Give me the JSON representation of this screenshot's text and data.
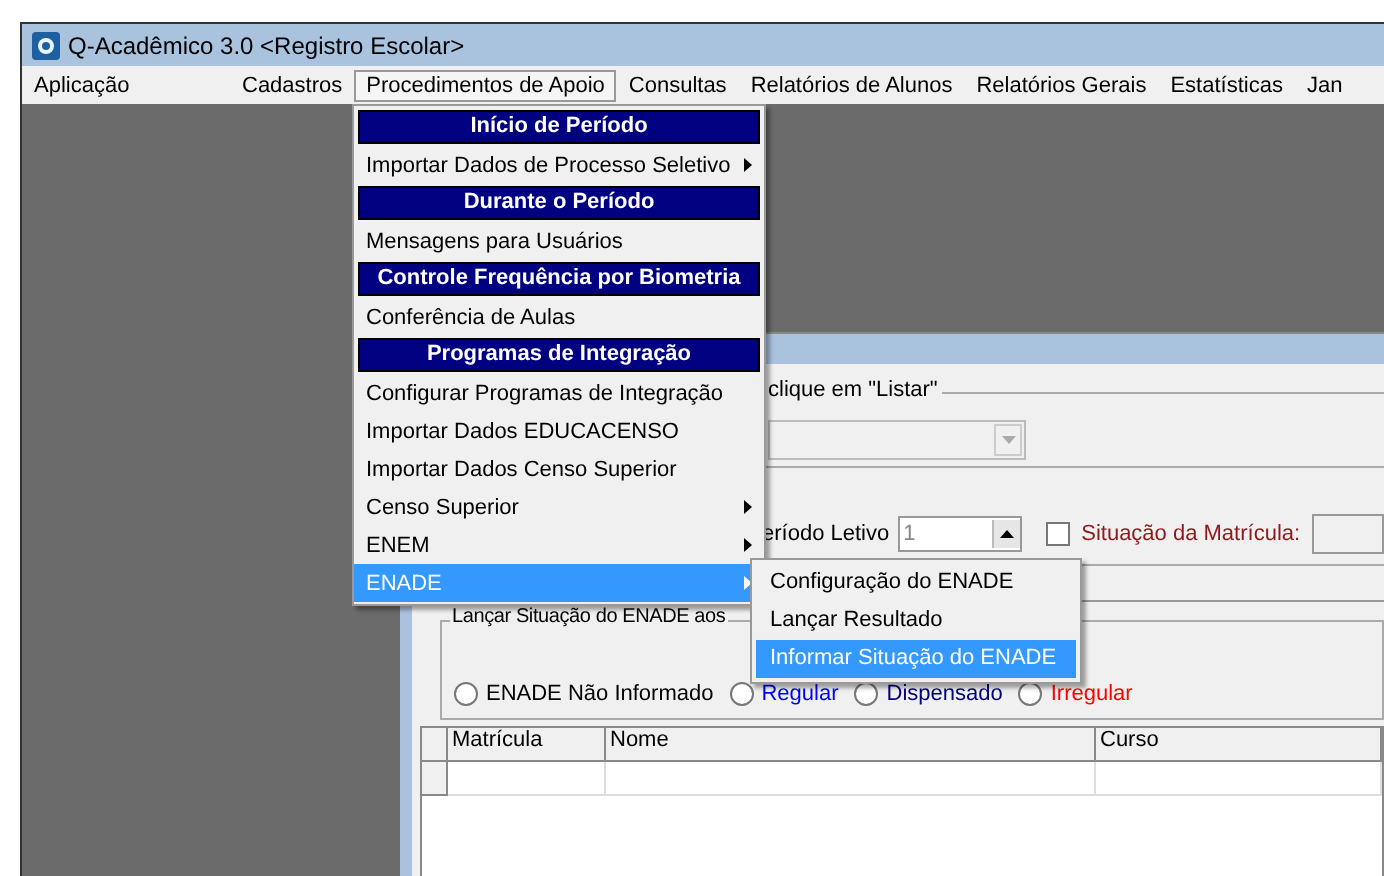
{
  "window": {
    "title": "Q-Acadêmico 3.0 <Registro Escolar>"
  },
  "menubar": [
    {
      "label": "Aplicação",
      "selected": false
    },
    {
      "label": "Cadastros",
      "selected": false
    },
    {
      "label": "Procedimentos de Apoio",
      "selected": true
    },
    {
      "label": "Consultas",
      "selected": false
    },
    {
      "label": "Relatórios de Alunos",
      "selected": false
    },
    {
      "label": "Relatórios Gerais",
      "selected": false
    },
    {
      "label": "Estatísticas",
      "selected": false
    },
    {
      "label": "Jan",
      "selected": false
    }
  ],
  "dropdown": {
    "items": [
      {
        "kind": "header",
        "label": "Início de Período"
      },
      {
        "kind": "item",
        "label": "Importar Dados de Processo Seletivo",
        "submenu": true,
        "selected": false
      },
      {
        "kind": "header",
        "label": "Durante o Período"
      },
      {
        "kind": "item",
        "label": "Mensagens para Usuários",
        "submenu": false,
        "selected": false
      },
      {
        "kind": "header",
        "label": "Controle Frequência por Biometria"
      },
      {
        "kind": "item",
        "label": "Conferência de Aulas",
        "submenu": false,
        "selected": false
      },
      {
        "kind": "header",
        "label": "Programas de Integração"
      },
      {
        "kind": "item",
        "label": "Configurar Programas de Integração",
        "submenu": false,
        "selected": false
      },
      {
        "kind": "item",
        "label": "Importar Dados EDUCACENSO",
        "submenu": false,
        "selected": false
      },
      {
        "kind": "item",
        "label": "Importar Dados Censo Superior",
        "submenu": false,
        "selected": false
      },
      {
        "kind": "item",
        "label": "Censo Superior",
        "submenu": true,
        "selected": false
      },
      {
        "kind": "item",
        "label": "ENEM",
        "submenu": true,
        "selected": false
      },
      {
        "kind": "item",
        "label": "ENADE",
        "submenu": true,
        "selected": true
      }
    ]
  },
  "submenu": {
    "items": [
      {
        "label": "Configuração do ENADE",
        "selected": false
      },
      {
        "label": "Lançar Resultado",
        "selected": false
      },
      {
        "label": "Informar Situação do ENADE",
        "selected": true
      }
    ]
  },
  "child_window": {
    "group_caption": "clique em \"Listar\"",
    "period_label": "eríodo Letivo",
    "period_value": "1",
    "status_filter": {
      "label": "Situação da Matrícula:",
      "checked": false
    },
    "enade_group": {
      "caption": "Lançar Situação do ENADE aos",
      "options": [
        {
          "label": "ENADE Não Informado",
          "selected": false,
          "color": "#000000"
        },
        {
          "label": "Regular",
          "selected": false,
          "color": "#0000ff"
        },
        {
          "label": "Dispensado",
          "selected": false,
          "color": "#000080"
        },
        {
          "label": "Irregular",
          "selected": false,
          "color": "#ff0000"
        }
      ]
    },
    "grid": {
      "columns": [
        "Matrícula",
        "Nome",
        "Curso"
      ]
    }
  }
}
